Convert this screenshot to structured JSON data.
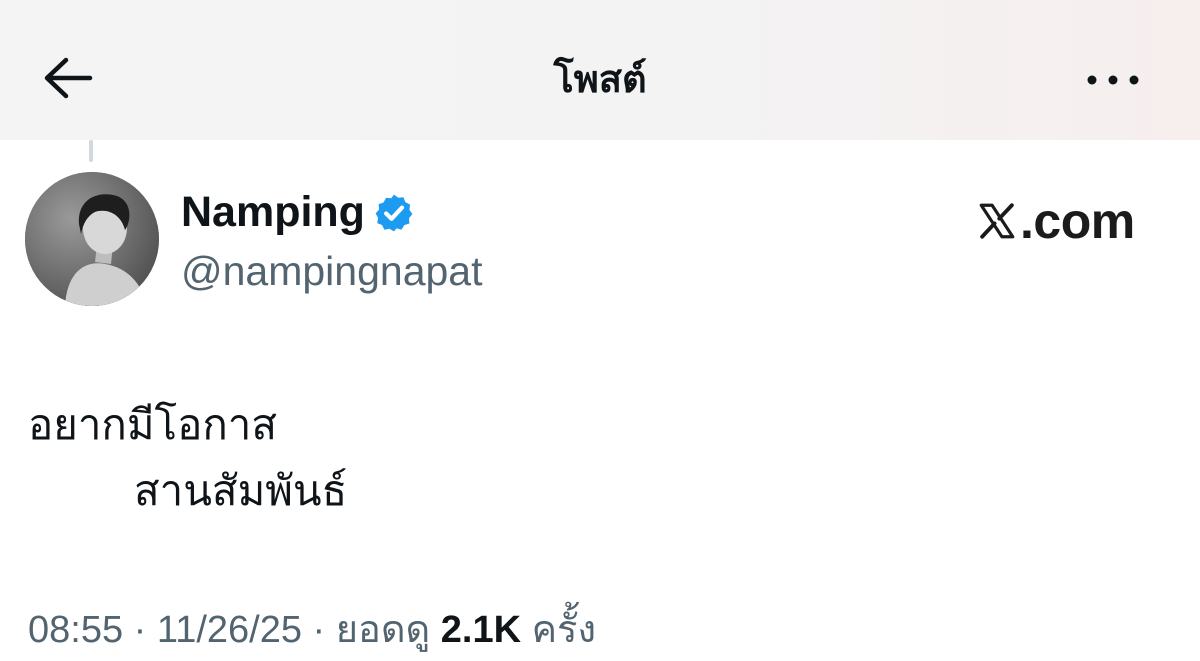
{
  "header": {
    "title": "โพสต์",
    "back_icon": "arrow-left-icon",
    "more_icon": "ellipsis-horizontal-icon"
  },
  "author": {
    "display_name": "Namping",
    "handle": "@nampingnapat",
    "verified": true,
    "verified_color": "#1d9bf0",
    "avatar": "monochrome portrait photo"
  },
  "watermark": {
    "icon": "x-logo-icon",
    "text": ".com"
  },
  "post": {
    "line1": "อยากมีโอกาส",
    "line2": "สานสัมพันธ์"
  },
  "meta": {
    "time": "08:55",
    "sep1": " · ",
    "date": "11/26/25",
    "sep2": " · ",
    "views_label": "ยอดดู",
    "views_count": "2.1K",
    "views_suffix": "ครั้ง"
  },
  "colors": {
    "text_primary": "#0f1419",
    "text_secondary": "#536471",
    "thread_line": "#cfd9de"
  }
}
